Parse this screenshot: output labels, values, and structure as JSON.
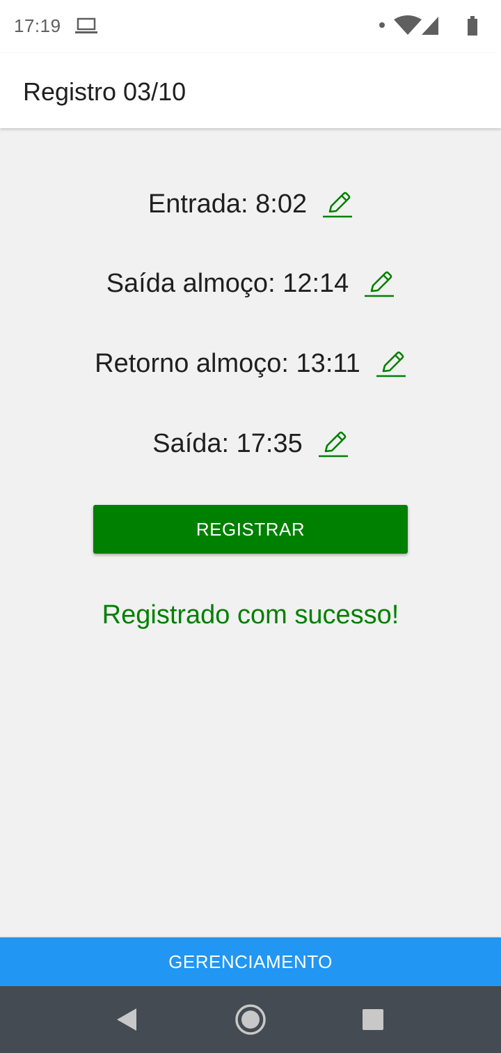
{
  "status_bar": {
    "time": "17:19",
    "icons": [
      "laptop-icon",
      "notification-dot-icon",
      "wifi-icon",
      "cell-signal-icon",
      "battery-icon"
    ]
  },
  "app_bar": {
    "title": "Registro 03/10"
  },
  "entries": [
    {
      "label": "Entrada: ",
      "value": "8:02",
      "icon": "pencil-edit-icon"
    },
    {
      "label": "Saída almoço: ",
      "value": "12:14",
      "icon": "pencil-edit-icon"
    },
    {
      "label": "Retorno almoço: ",
      "value": "13:11",
      "icon": "pencil-edit-icon"
    },
    {
      "label": "Saída: ",
      "value": "17:35",
      "icon": "pencil-edit-icon"
    }
  ],
  "actions": {
    "register_label": "REGISTRAR",
    "success_message": "Registrado com sucesso!",
    "management_label": "GERENCIAMENTO"
  },
  "colors": {
    "accent_green": "#008000",
    "management_blue": "#2196f3",
    "nav_bar": "#444b52",
    "background": "#f1f1f1"
  },
  "nav_bar": {
    "buttons": [
      "back-icon",
      "home-icon",
      "recents-icon"
    ]
  }
}
